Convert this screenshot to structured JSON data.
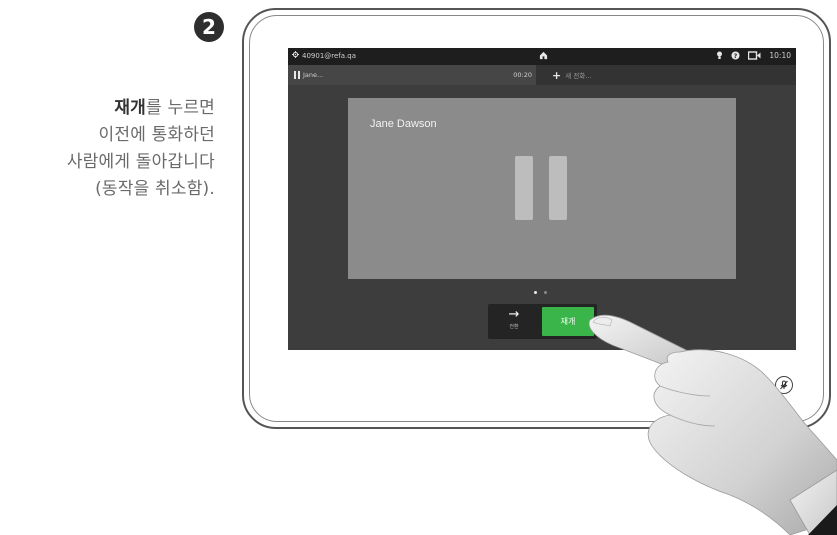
{
  "step": {
    "number": "2"
  },
  "instruction": {
    "bold": "재개",
    "line1_rest": "를 누르면",
    "line2": "이전에 통화하던",
    "line3": "사람에게 돌아갑니다",
    "line4": "(동작을 취소함)."
  },
  "statusbar": {
    "sip_address": "40901@refa.qa",
    "time": "10:10",
    "icons": [
      "gear-icon",
      "home-icon",
      "lightbulb-icon",
      "help-icon",
      "camera-icon"
    ]
  },
  "callbar": {
    "active_call_name": "Jane...",
    "active_call_timer": "00:20",
    "new_call_label": "새 전화..."
  },
  "video": {
    "caller_name": "Jane Dawson"
  },
  "pagination": {
    "count": 2,
    "active_index": 0
  },
  "actions": {
    "transfer_label": "전환",
    "resume_label": "재개"
  },
  "colors": {
    "accent": "#3ab54a",
    "statusbar": "#1e1e1e",
    "screen": "#3d3d3d",
    "video": "#8b8b8b"
  }
}
